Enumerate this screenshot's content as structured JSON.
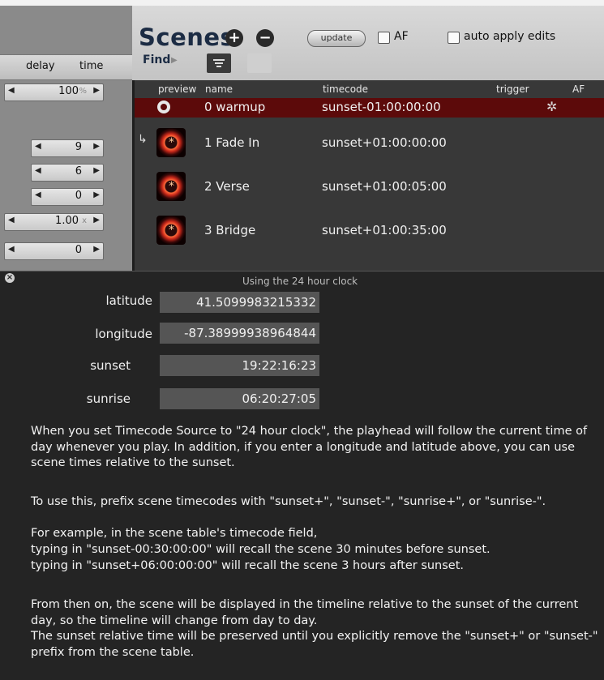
{
  "left_panel": {
    "columns": [
      "delay",
      "time"
    ],
    "steppers": [
      {
        "value": "100",
        "unit": "%"
      },
      {
        "value": "9",
        "unit": ""
      },
      {
        "value": "6",
        "unit": ""
      },
      {
        "value": "0",
        "unit": ""
      },
      {
        "value": "1.00",
        "unit": "x"
      },
      {
        "value": "0",
        "unit": ""
      }
    ]
  },
  "toolbar": {
    "title": "Scenes",
    "add_glyph": "+",
    "remove_glyph": "−",
    "update_label": "update",
    "af_label": "AF",
    "auto_apply_label": "auto apply edits",
    "find_label": "Find"
  },
  "table": {
    "headers": {
      "preview": "preview",
      "name": "name",
      "timecode": "timecode",
      "trigger": "trigger",
      "af": "AF"
    },
    "rows": [
      {
        "name": "0 warmup",
        "timecode": "sunset-01:00:00:00",
        "selected": true
      },
      {
        "name": "1 Fade In",
        "timecode": "sunset+01:00:00:00",
        "selected": false
      },
      {
        "name": "2 Verse",
        "timecode": "sunset+01:00:05:00",
        "selected": false
      },
      {
        "name": "3 Bridge",
        "timecode": "sunset+01:00:35:00",
        "selected": false
      }
    ],
    "selected_color": "#5c0a0a"
  },
  "clock_panel": {
    "title": "Using the 24 hour clock",
    "fields": [
      {
        "label": "latitude",
        "value": "41.5099983215332"
      },
      {
        "label": "longitude",
        "value": "-87.38999938964844"
      },
      {
        "label": "sunset",
        "value": "19:22:16:23"
      },
      {
        "label": "sunrise",
        "value": "06:20:27:05"
      }
    ],
    "paragraphs": [
      "When you set Timecode Source to \"24 hour clock\", the playhead will follow the current time of day whenever you play.  In addition, if you enter a longitude and latitude above, you can use scene times relative to the sunset.",
      "To use this, prefix scene timecodes with \"sunset+\", \"sunset-\", \"sunrise+\", or \"sunrise-\".",
      "For example, in the scene table's timecode field,",
      "typing in \"sunset-00:30:00:00\" will recall the scene 30 minutes before sunset.",
      "typing in \"sunset+06:00:00:00\" will recall the scene 3 hours after sunset.",
      "From then on, the scene will be displayed in the timeline relative to the sunset of the current day, so the timeline will change from day to day.",
      "The sunset relative time will be preserved until you explicitly remove the \"sunset+\" or \"sunset-\" prefix from the scene table."
    ]
  }
}
